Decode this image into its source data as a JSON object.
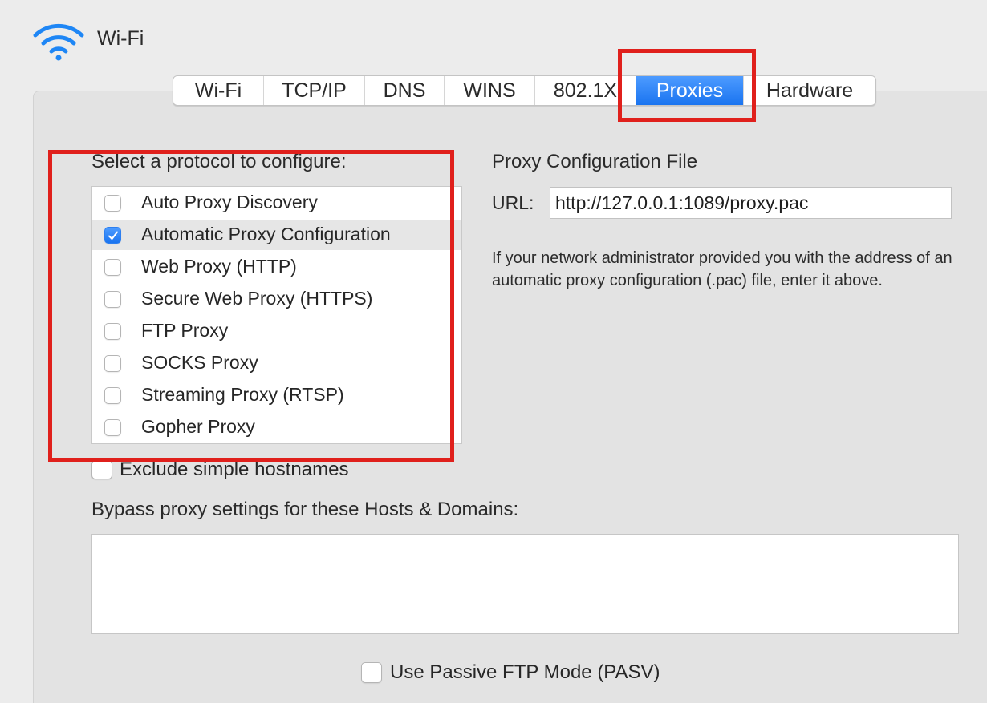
{
  "window": {
    "title": "Wi-Fi",
    "icon": "wifi-icon"
  },
  "tabs": [
    {
      "label": "Wi-Fi",
      "active": false
    },
    {
      "label": "TCP/IP",
      "active": false
    },
    {
      "label": "DNS",
      "active": false
    },
    {
      "label": "WINS",
      "active": false
    },
    {
      "label": "802.1X",
      "active": false
    },
    {
      "label": "Proxies",
      "active": true
    },
    {
      "label": "Hardware",
      "active": false
    }
  ],
  "protocols": {
    "heading": "Select a protocol to configure:",
    "items": [
      {
        "label": "Auto Proxy Discovery",
        "checked": false,
        "selected": false
      },
      {
        "label": "Automatic Proxy Configuration",
        "checked": true,
        "selected": true
      },
      {
        "label": "Web Proxy (HTTP)",
        "checked": false,
        "selected": false
      },
      {
        "label": "Secure Web Proxy (HTTPS)",
        "checked": false,
        "selected": false
      },
      {
        "label": "FTP Proxy",
        "checked": false,
        "selected": false
      },
      {
        "label": "SOCKS Proxy",
        "checked": false,
        "selected": false
      },
      {
        "label": "Streaming Proxy (RTSP)",
        "checked": false,
        "selected": false
      },
      {
        "label": "Gopher Proxy",
        "checked": false,
        "selected": false
      }
    ]
  },
  "pac": {
    "heading": "Proxy Configuration File",
    "url_label": "URL:",
    "url_value": "http://127.0.0.1:1089/proxy.pac",
    "help_text": "If your network administrator provided you with the address of an automatic proxy configuration (.pac) file, enter it above."
  },
  "options": {
    "exclude_simple_hostnames": {
      "label": "Exclude simple hostnames",
      "checked": false
    },
    "bypass_heading": "Bypass proxy settings for these Hosts & Domains:",
    "bypass_value": "",
    "passive_ftp": {
      "label": "Use Passive FTP Mode (PASV)",
      "checked": false
    }
  },
  "colors": {
    "accent": "#1a74f0",
    "highlight_box": "#e0201c"
  }
}
